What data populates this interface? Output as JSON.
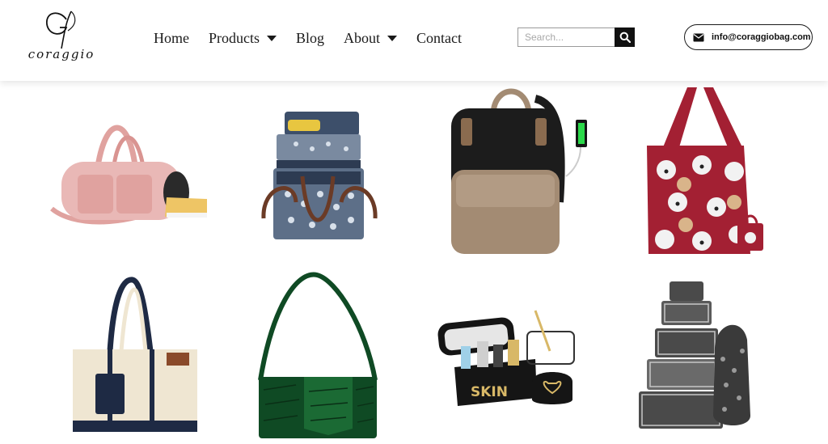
{
  "brand": {
    "name": "coraggio",
    "monogram": "G",
    "icon": "coraggio-logo"
  },
  "nav": {
    "items": [
      {
        "label": "Home",
        "has_dropdown": false
      },
      {
        "label": "Products",
        "has_dropdown": true
      },
      {
        "label": "Blog",
        "has_dropdown": false
      },
      {
        "label": "About",
        "has_dropdown": true
      },
      {
        "label": "Contact",
        "has_dropdown": false
      }
    ]
  },
  "search": {
    "placeholder": "Search...",
    "value": "",
    "icon": "search-icon"
  },
  "contact": {
    "email": "info@coraggiobag.com",
    "icon": "envelope-icon"
  },
  "products": [
    {
      "type": "pink duffel gym bag with shoe compartment",
      "colors": [
        "#e9b8b6",
        "#e0a29f",
        "#eec565"
      ]
    },
    {
      "type": "double-decker insulated lunch cooler bag",
      "colors": [
        "#3d4f6a",
        "#7a8aa0",
        "#6b3b26"
      ]
    },
    {
      "type": "black and khaki laptop backpack with USB port",
      "colors": [
        "#1c1c1c",
        "#a38b73",
        "#8a6b4f"
      ]
    },
    {
      "type": "red foldable reusable shopping tote with dog print",
      "colors": [
        "#a32033",
        "#f2f2f2",
        "#d9b48a"
      ]
    },
    {
      "type": "canvas tote bag with navy straps",
      "colors": [
        "#efe6d2",
        "#1e2a44",
        "#8a4a2a"
      ]
    },
    {
      "type": "green croc-embossed shoulder bag",
      "colors": [
        "#0f4a24",
        "#1b6a34",
        "#0a2f16"
      ]
    },
    {
      "type": "black travel makeup bag set",
      "colors": [
        "#151515",
        "#d8b867",
        "#e6e6e6"
      ]
    },
    {
      "type": "grey packing cubes set with laundry bag",
      "colors": [
        "#4a4a4a",
        "#7a7a7a",
        "#c8c8c8"
      ]
    }
  ]
}
